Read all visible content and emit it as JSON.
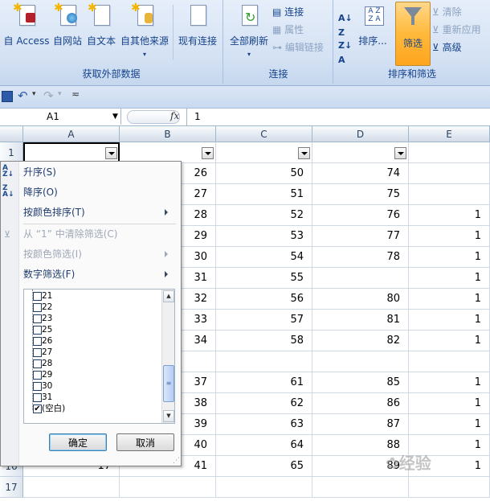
{
  "ribbon": {
    "external_group": {
      "title": "获取外部数据",
      "buttons": [
        "自 Access",
        "自网站",
        "自文本",
        "自其他来源",
        "现有连接"
      ]
    },
    "connections_group": {
      "title": "连接",
      "refresh_all": "全部刷新",
      "connections": "连接",
      "properties": "属性",
      "edit_links": "编辑链接"
    },
    "sort_filter_group": {
      "title": "排序和筛选",
      "sort": "排序...",
      "filter": "筛选",
      "clear": "清除",
      "reapply": "重新应用",
      "advanced": "高级"
    }
  },
  "formula_bar": {
    "name_box": "A1",
    "fx": "fx",
    "value": "1"
  },
  "columns": [
    "A",
    "B",
    "C",
    "D",
    "E"
  ],
  "rows": [
    {
      "n": "1",
      "a": "",
      "b": "",
      "c": "",
      "d": "",
      "e": ""
    },
    {
      "n": "",
      "a": "",
      "b": "26",
      "c": "50",
      "d": "74",
      "e": ""
    },
    {
      "n": "",
      "a": "",
      "b": "27",
      "c": "51",
      "d": "75",
      "e": ""
    },
    {
      "n": "",
      "a": "",
      "b": "28",
      "c": "52",
      "d": "76",
      "e": "1"
    },
    {
      "n": "",
      "a": "",
      "b": "29",
      "c": "53",
      "d": "77",
      "e": "1"
    },
    {
      "n": "",
      "a": "",
      "b": "30",
      "c": "54",
      "d": "78",
      "e": "1"
    },
    {
      "n": "",
      "a": "",
      "b": "31",
      "c": "55",
      "d": "",
      "e": "1"
    },
    {
      "n": "",
      "a": "",
      "b": "32",
      "c": "56",
      "d": "80",
      "e": "1"
    },
    {
      "n": "",
      "a": "",
      "b": "33",
      "c": "57",
      "d": "81",
      "e": "1"
    },
    {
      "n": "",
      "a": "",
      "b": "34",
      "c": "58",
      "d": "82",
      "e": "1"
    },
    {
      "n": "",
      "a": "",
      "b": "",
      "c": "",
      "d": "",
      "e": ""
    },
    {
      "n": "",
      "a": "",
      "b": "37",
      "c": "61",
      "d": "85",
      "e": "1"
    },
    {
      "n": "",
      "a": "",
      "b": "38",
      "c": "62",
      "d": "86",
      "e": "1"
    },
    {
      "n": "",
      "a": "",
      "b": "39",
      "c": "63",
      "d": "87",
      "e": "1"
    },
    {
      "n": "",
      "a": "",
      "b": "40",
      "c": "64",
      "d": "88",
      "e": "1"
    },
    {
      "n": "16",
      "a": "17",
      "b": "41",
      "c": "65",
      "d": "89",
      "e": "1"
    },
    {
      "n": "17",
      "a": "",
      "b": "",
      "c": "",
      "d": "",
      "e": ""
    }
  ],
  "filter_menu": {
    "sort_asc": "升序(S)",
    "sort_desc": "降序(O)",
    "sort_by_color": "按颜色排序(T)",
    "clear_filter": "从 “1” 中清除筛选(C)",
    "filter_by_color": "按颜色筛选(I)",
    "number_filters": "数字筛选(F)",
    "values": [
      {
        "label": "21",
        "checked": false
      },
      {
        "label": "22",
        "checked": false
      },
      {
        "label": "23",
        "checked": false
      },
      {
        "label": "25",
        "checked": false
      },
      {
        "label": "26",
        "checked": false
      },
      {
        "label": "27",
        "checked": false
      },
      {
        "label": "28",
        "checked": false
      },
      {
        "label": "29",
        "checked": false
      },
      {
        "label": "30",
        "checked": false
      },
      {
        "label": "31",
        "checked": false
      },
      {
        "label": "(空白)",
        "checked": true
      }
    ],
    "ok": "确定",
    "cancel": "取消"
  },
  "watermark": "经验"
}
